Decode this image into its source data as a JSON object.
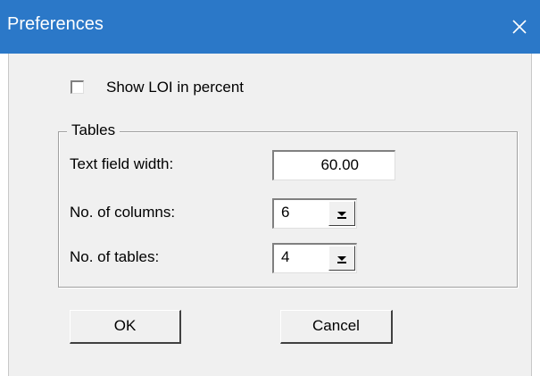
{
  "window": {
    "title": "Preferences",
    "close_icon": "close-icon",
    "accent_color": "#2b78c8"
  },
  "options": {
    "show_loi_label": "Show LOI in percent",
    "show_loi_checked": false
  },
  "tables_group": {
    "legend": "Tables",
    "text_field_width_label": "Text field width:",
    "text_field_width_value": "60.00",
    "columns_label": "No. of columns:",
    "columns_value": "6",
    "tables_label": "No. of tables:",
    "tables_value": "4"
  },
  "buttons": {
    "ok": "OK",
    "cancel": "Cancel"
  }
}
